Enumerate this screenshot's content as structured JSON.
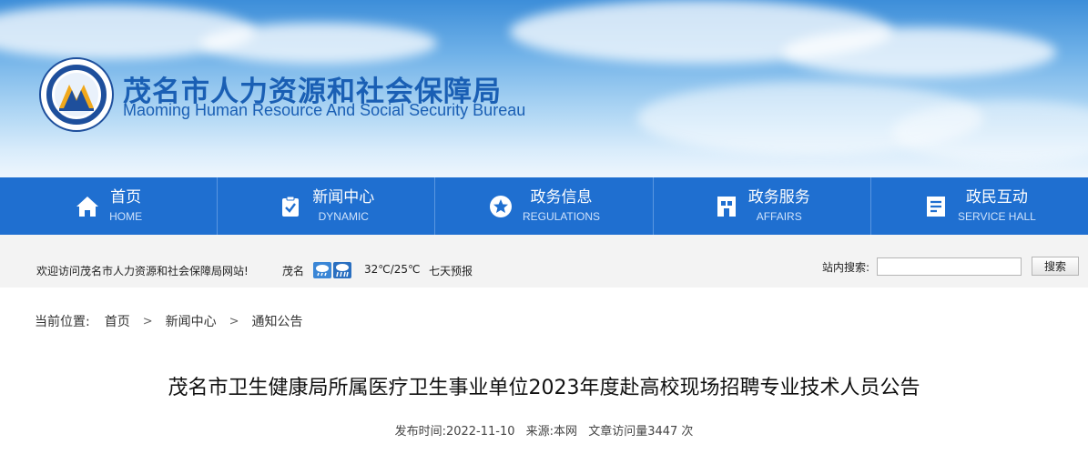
{
  "header": {
    "title_cn": "茂名市人力资源和社会保障局",
    "title_en": "Maoming Human Resource And Social Security Bureau",
    "logo_icon": "ministry-emblem-icon"
  },
  "nav": [
    {
      "label": "首页",
      "en": "HOME",
      "icon": "home-icon"
    },
    {
      "label": "新闻中心",
      "en": "DYNAMIC",
      "icon": "clipboard-check-icon"
    },
    {
      "label": "政务信息",
      "en": "REGULATIONS",
      "icon": "star-badge-icon"
    },
    {
      "label": "政务服务",
      "en": "AFFAIRS",
      "icon": "service-icon"
    },
    {
      "label": "政民互动",
      "en": "SERVICE HALL",
      "icon": "interaction-icon"
    }
  ],
  "infobar": {
    "welcome": "欢迎访问茂名市人力资源和社会保障局网站!",
    "city": "茂名",
    "weather_icons": [
      "rain-cloud-icon",
      "heavy-rain-cloud-icon"
    ],
    "temperature": "32℃/25℃",
    "forecast": "七天预报",
    "search_label": "站内搜索:",
    "search_value": "",
    "search_button": "搜索"
  },
  "breadcrumb": {
    "prefix": "当前位置:",
    "items": [
      "首页",
      "新闻中心",
      "通知公告"
    ]
  },
  "article": {
    "title": "茂名市卫生健康局所属医疗卫生事业单位2023年度赴高校现场招聘专业技术人员公告",
    "publish_time": "发布时间:2022-11-10",
    "source": "来源:本网",
    "views": "文章访问量3447 次"
  },
  "colors": {
    "nav_bg": "#1f6fd0",
    "title_blue": "#1a5fb4",
    "infobar_bg": "#f3f3f3"
  }
}
